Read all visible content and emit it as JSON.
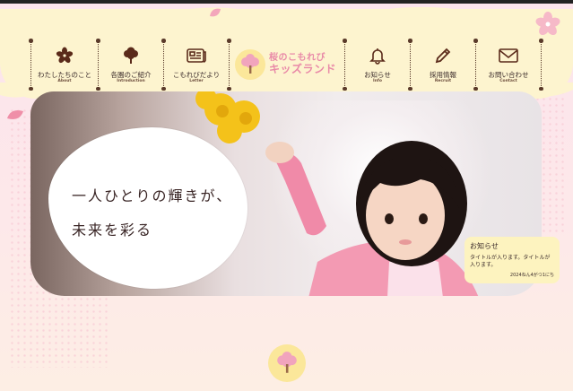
{
  "nav": {
    "items_left": [
      {
        "label": "わたしたちのこと",
        "sub": "About",
        "icon": "sakura-icon"
      },
      {
        "label": "各園のご紹介",
        "sub": "Introduction",
        "icon": "tree-icon"
      },
      {
        "label": "こもれびだより",
        "sub": "Letter",
        "icon": "newspaper-icon"
      }
    ],
    "logo": {
      "line1": "桜のこもれび",
      "line2": "キッズランド"
    },
    "items_right": [
      {
        "label": "お知らせ",
        "sub": "Info",
        "icon": "bell-icon"
      },
      {
        "label": "採用情報",
        "sub": "Recruit",
        "icon": "pen-icon"
      },
      {
        "label": "お問い合わせ",
        "sub": "Contact",
        "icon": "mail-icon"
      }
    ]
  },
  "hero": {
    "line1": "一人ひとりの輝きが、",
    "line2": "未来を彩る"
  },
  "notice": {
    "title": "お知らせ",
    "body": "タイトルが入ります。タイトルが入ります。",
    "date": "2024ねん4がつ1にち"
  },
  "colors": {
    "accent_pink": "#e98aa8",
    "nav_bg": "#fdf4cf",
    "page_bg": "#fce4ec",
    "notice_bg": "#fdf3bf"
  }
}
